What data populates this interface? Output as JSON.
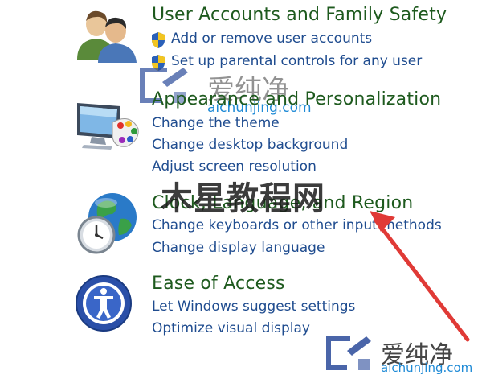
{
  "categories": [
    {
      "title": "User Accounts and Family Safety",
      "icon": "users-icon",
      "tasks": [
        "Add or remove user accounts",
        "Set up parental controls for any user"
      ]
    },
    {
      "title": "Appearance and Personalization",
      "icon": "monitor-palette-icon",
      "tasks": [
        "Change the theme",
        "Change desktop background",
        "Adjust screen resolution"
      ]
    },
    {
      "title": "Clock, Language, and Region",
      "icon": "globe-clock-icon",
      "tasks": [
        "Change keyboards or other input methods",
        "Change display language"
      ]
    },
    {
      "title": "Ease of Access",
      "icon": "ease-of-access-icon",
      "tasks": [
        "Let Windows suggest settings",
        "Optimize visual display"
      ]
    }
  ],
  "watermarks": {
    "brand_zh": "爱纯净",
    "brand_url": "aichunjing.com",
    "overlay_text": "木星教程网"
  },
  "colors": {
    "category_title": "#1e5a1e",
    "task_link": "#1f4c8f",
    "annotation_arrow": "#e03a36"
  }
}
